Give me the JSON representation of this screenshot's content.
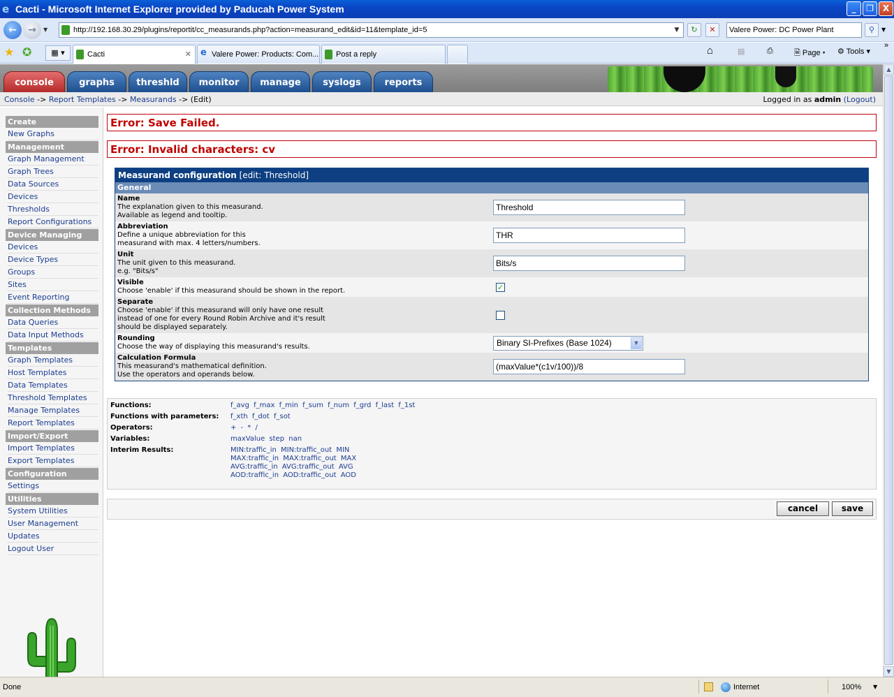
{
  "window": {
    "title": "Cacti - Microsoft Internet Explorer provided by Paducah Power System",
    "minimize": "_",
    "maximize": "❐",
    "close": "X"
  },
  "address_bar": {
    "url": "http://192.168.30.29/plugins/reportit/cc_measurands.php?action=measurand_edit&id=11&template_id=5",
    "search_value": "Valere Power: DC Power Plant"
  },
  "browser_tabs": [
    {
      "label": "Cacti",
      "active": true
    },
    {
      "label": "Valere Power: Products: Com...",
      "active": false
    },
    {
      "label": "Post a reply",
      "active": false
    }
  ],
  "command_bar": {
    "page": "Page",
    "tools": "Tools"
  },
  "cacti": {
    "tabs": [
      "console",
      "graphs",
      "threshld",
      "monitor",
      "manage",
      "syslogs",
      "reports"
    ],
    "breadcrumb": {
      "console": "Console",
      "report_templates": "Report Templates",
      "measurands": "Measurands",
      "edit": "(Edit)",
      "sep": "->"
    },
    "login": {
      "prefix": "Logged in as",
      "user": "admin",
      "logout": "(Logout)"
    }
  },
  "sidebar": {
    "create_head": "Create",
    "create_items": [
      "New Graphs"
    ],
    "management_head": "Management",
    "management_items": [
      "Graph Management",
      "Graph Trees",
      "Data Sources",
      "Devices",
      "Thresholds",
      "Report Configurations"
    ],
    "device_managing_head": "Device Managing",
    "device_managing_items": [
      "Devices",
      "Device Types",
      "Groups",
      "Sites",
      "Event Reporting"
    ],
    "collection_head": "Collection Methods",
    "collection_items": [
      "Data Queries",
      "Data Input Methods"
    ],
    "templates_head": "Templates",
    "templates_items": [
      "Graph Templates",
      "Host Templates",
      "Data Templates",
      "Threshold Templates",
      "Manage Templates",
      "Report Templates"
    ],
    "import_head": "Import/Export",
    "import_items": [
      "Import Templates",
      "Export Templates"
    ],
    "config_head": "Configuration",
    "config_items": [
      "Settings"
    ],
    "utilities_head": "Utilities",
    "utilities_items": [
      "System Utilities",
      "User Management",
      "Updates",
      "Logout User"
    ]
  },
  "errors": {
    "save_failed": "Error: Save Failed.",
    "invalid_chars": "Error: Invalid characters: cv"
  },
  "form": {
    "title": "Measurand configuration",
    "title_suffix": "[edit: Threshold]",
    "section": "General",
    "name": {
      "label": "Name",
      "desc1": "The explanation given to this measurand.",
      "desc2": "Available as legend and tooltip.",
      "value": "Threshold"
    },
    "abbreviation": {
      "label": "Abbreviation",
      "desc1": "Define a unique abbreviation for this",
      "desc2": "measurand with max. 4 letters/numbers.",
      "value": "THR"
    },
    "unit": {
      "label": "Unit",
      "desc1": "The unit given to this measurand.",
      "desc2": "e.g. \"Bits/s\"",
      "value": "Bits/s"
    },
    "visible": {
      "label": "Visible",
      "desc1": "Choose 'enable' if this measurand should be shown in the report.",
      "checked": true,
      "check_glyph": "✓"
    },
    "separate": {
      "label": "Separate",
      "desc1": "Choose 'enable' if this measurand will only have one result",
      "desc2": "instead of one for every Round Robin Archive and it's result",
      "desc3": "should be displayed separately.",
      "checked": false
    },
    "rounding": {
      "label": "Rounding",
      "desc1": "Choose the way of displaying this measurand's results.",
      "value": "Binary SI-Prefixes (Base 1024)"
    },
    "formula": {
      "label": "Calculation Formula",
      "desc1": "This measurand's mathematical definition.",
      "desc2": "Use the operators and operands below.",
      "value": "(maxValue*(c1v/100))/8"
    }
  },
  "help": {
    "functions_label": "Functions:",
    "functions": "f_avg  f_max  f_min  f_sum  f_num  f_grd  f_last  f_1st",
    "functions_params_label": "Functions with parameters:",
    "functions_params": "f_xth  f_dot  f_sot",
    "operators_label": "Operators:",
    "operators": "+  -  *  /",
    "variables_label": "Variables:",
    "variables": "maxValue  step  nan",
    "interim_label": "Interim Results:",
    "interim_1": "MIN:traffic_in  MIN:traffic_out  MIN",
    "interim_2": "MAX:traffic_in  MAX:traffic_out  MAX",
    "interim_3": "AVG:traffic_in  AVG:traffic_out  AVG",
    "interim_4": "AOD:traffic_in  AOD:traffic_out  AOD"
  },
  "actions": {
    "cancel": "cancel",
    "save": "save"
  },
  "statusbar": {
    "status": "Done",
    "zone": "Internet",
    "zoom": "100%"
  }
}
